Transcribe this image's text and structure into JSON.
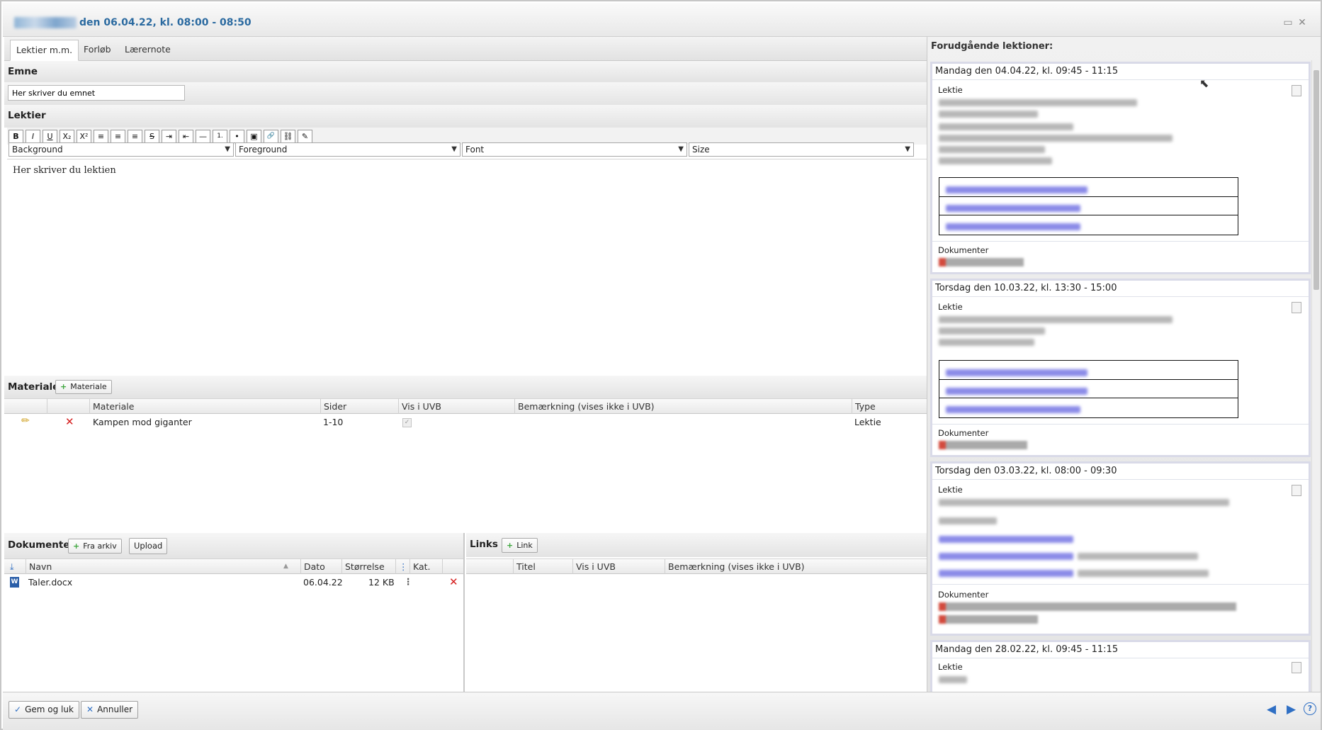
{
  "window": {
    "title": "den 06.04.22, kl. 08:00 - 08:50"
  },
  "tabs": [
    "Lektier m.m.",
    "Forløb",
    "Lærernote"
  ],
  "emne": {
    "label": "Emne",
    "value": "Her skriver du emnet"
  },
  "lektier": {
    "label": "Lektier",
    "editor_text": "Her skriver du lektien",
    "toolbar": [
      "B",
      "I",
      "U",
      "X₂",
      "X²",
      "≡",
      "≡",
      "≡",
      "S",
      "⇥",
      "⇤",
      "—",
      "1.",
      "•",
      "▣",
      "🔗",
      "⛓",
      "✎"
    ],
    "selects": {
      "background": "Background",
      "foreground": "Foreground",
      "font": "Font",
      "size": "Size"
    }
  },
  "materiale": {
    "label": "Materiale",
    "add_button": "Materiale",
    "columns": [
      "Materiale",
      "Sider",
      "Vis i UVB",
      "Bemærkning (vises ikke i UVB)",
      "Type"
    ],
    "rows": [
      {
        "materiale": "Kampen mod giganter",
        "sider": "1-10",
        "vis_i_uvb": true,
        "bemaerkning": "",
        "type": "Lektie"
      }
    ]
  },
  "dokumenter": {
    "label": "Dokumenter",
    "fra_arkiv": "Fra arkiv",
    "upload": "Upload",
    "columns": [
      "Navn",
      "Dato",
      "Størrelse",
      "Kat."
    ],
    "rows": [
      {
        "navn": "Taler.docx",
        "dato": "06.04.22",
        "stoerrelse": "12 KB"
      }
    ]
  },
  "links": {
    "label": "Links",
    "add_button": "Link",
    "columns": [
      "Titel",
      "Vis i UVB",
      "Bemærkning (vises ikke i UVB)"
    ]
  },
  "previous": {
    "header": "Forudgående lektioner:",
    "cards": [
      {
        "date": "Mandag den 04.04.22, kl. 09:45 - 11:15",
        "lektie_label": "Lektie",
        "dokumenter_label": "Dokumenter"
      },
      {
        "date": "Torsdag den 10.03.22, kl. 13:30 - 15:00",
        "lektie_label": "Lektie",
        "dokumenter_label": "Dokumenter"
      },
      {
        "date": "Torsdag den 03.03.22, kl. 08:00 - 09:30",
        "lektie_label": "Lektie",
        "dokumenter_label": "Dokumenter"
      },
      {
        "date": "Mandag den 28.02.22, kl. 09:45 - 11:15",
        "lektie_label": "Lektie"
      }
    ]
  },
  "footer": {
    "save": "Gem og luk",
    "cancel": "Annuller"
  },
  "colors": {
    "title_blue": "#2b6aa0",
    "nav_blue": "#2f6fc4",
    "delete_red": "#d62020",
    "add_green": "#3da63d"
  }
}
